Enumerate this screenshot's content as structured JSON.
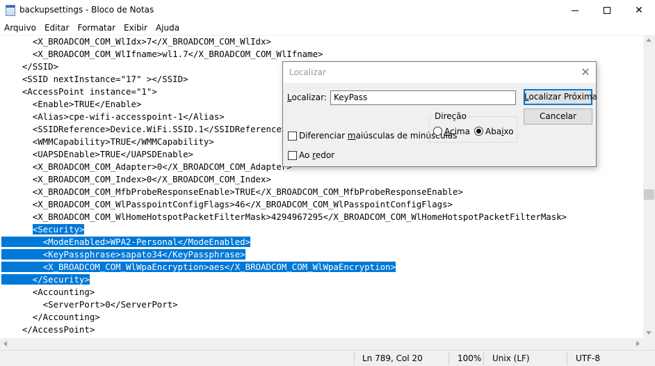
{
  "window": {
    "title": "backupsettings - Bloco de Notas",
    "minimize_glyph": "",
    "maximize_glyph": "",
    "close_glyph": "✕"
  },
  "menu": [
    "Arquivo",
    "Editar",
    "Formatar",
    "Exibir",
    "Ajuda"
  ],
  "editor": {
    "lines": [
      {
        "text": "      <X_BROADCOM_COM_WlIdx>7</X_BROADCOM_COM_WlIdx>",
        "selected": false
      },
      {
        "text": "      <X_BROADCOM_COM_WlIfname>wl1.7</X_BROADCOM_COM_WlIfname>",
        "selected": false
      },
      {
        "text": "    </SSID>",
        "selected": false
      },
      {
        "text": "    <SSID nextInstance=\"17\" ></SSID>",
        "selected": false
      },
      {
        "text": "    <AccessPoint instance=\"1\">",
        "selected": false
      },
      {
        "text": "      <Enable>TRUE</Enable>",
        "selected": false
      },
      {
        "text": "      <Alias>cpe-wifi-accesspoint-1</Alias>",
        "selected": false
      },
      {
        "text": "      <SSIDReference>Device.WiFi.SSID.1</SSIDReference>",
        "selected": false
      },
      {
        "text": "      <WMMCapability>TRUE</WMMCapability>",
        "selected": false
      },
      {
        "text": "      <UAPSDEnable>TRUE</UAPSDEnable>",
        "selected": false
      },
      {
        "text": "      <X_BROADCOM_COM_Adapter>0</X_BROADCOM_COM_Adapter>",
        "selected": false
      },
      {
        "text": "      <X_BROADCOM_COM_Index>0</X_BROADCOM_COM_Index>",
        "selected": false
      },
      {
        "text": "      <X_BROADCOM_COM_MfbProbeResponseEnable>TRUE</X_BROADCOM_COM_MfbProbeResponseEnable>",
        "selected": false
      },
      {
        "text": "      <X_BROADCOM_COM_WlPasspointConfigFlags>46</X_BROADCOM_COM_WlPasspointConfigFlags>",
        "selected": false
      },
      {
        "text": "      <X_BROADCOM_COM_WlHomeHotspotPacketFilterMask>4294967295</X_BROADCOM_COM_WlHomeHotspotPacketFilterMask>",
        "selected": false
      },
      {
        "text": "      <Security>",
        "selected": true,
        "indent": "      "
      },
      {
        "text": "        <ModeEnabled>WPA2-Personal</ModeEnabled>",
        "selected": true
      },
      {
        "text": "        <KeyPassphrase>sapato34</KeyPassphrase>",
        "selected": true
      },
      {
        "text": "        <X_BROADCOM_COM_WlWpaEncryption>aes</X_BROADCOM_COM_WlWpaEncryption>",
        "selected": true
      },
      {
        "text": "      </Security>",
        "selected": true,
        "partial_end": true
      },
      {
        "text": "      <Accounting>",
        "selected": false
      },
      {
        "text": "        <ServerPort>0</ServerPort>",
        "selected": false
      },
      {
        "text": "      </Accounting>",
        "selected": false
      },
      {
        "text": "    </AccessPoint>",
        "selected": false
      }
    ]
  },
  "status": {
    "position": "Ln 789, Col 20",
    "zoom": "100%",
    "line_ending": "Unix (LF)",
    "encoding": "UTF-8"
  },
  "find_dialog": {
    "title": "Localizar",
    "close_glyph": "✕",
    "find_label_pre": "",
    "find_label_u": "L",
    "find_label_post": "ocalizar:",
    "find_value": "KeyPass",
    "find_next_pre": "",
    "find_next_u": "L",
    "find_next_post": "ocalizar Próxima",
    "cancel": "Cancelar",
    "match_case_pre": "Diferenciar ",
    "match_case_u": "m",
    "match_case_post": "aiúsculas de minúsculas",
    "wrap_pre": "Ao ",
    "wrap_u": "r",
    "wrap_post": "edor",
    "direction_title": "Direção",
    "up_u": "A",
    "up_post": "cima",
    "down_pre": "Aba",
    "down_u": "i",
    "down_post": "xo",
    "direction_selected": "down",
    "match_case_checked": false,
    "wrap_checked": false
  }
}
